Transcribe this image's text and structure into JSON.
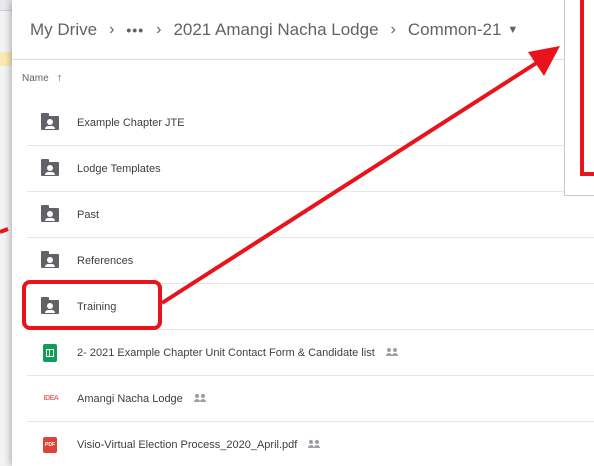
{
  "breadcrumb": {
    "root": "My Drive",
    "more": "•••",
    "folder": "2021 Amangi Nacha Lodge",
    "current": "Common-21"
  },
  "list": {
    "column_header": "Name",
    "sort_icon": "arrow-up-icon"
  },
  "files": [
    {
      "type": "shared-folder",
      "name": "Example Chapter JTE",
      "shared": false
    },
    {
      "type": "shared-folder",
      "name": "Lodge Templates",
      "shared": false
    },
    {
      "type": "shared-folder",
      "name": "Past",
      "shared": false
    },
    {
      "type": "shared-folder",
      "name": "References",
      "shared": false
    },
    {
      "type": "shared-folder",
      "name": "Training",
      "shared": false
    },
    {
      "type": "google-sheet",
      "name": "2- 2021 Example Chapter Unit Contact Form & Candidate list",
      "shared": true
    },
    {
      "type": "image",
      "name": "Amangi Nacha Lodge",
      "shared": true,
      "icon_text": "IDEA"
    },
    {
      "type": "pdf",
      "name": "Visio-Virtual Election Process_2020_April.pdf",
      "shared": true,
      "icon_text": "PDF"
    }
  ],
  "colors": {
    "annotation_red": "#e8131b",
    "folder_gray": "#5f6368",
    "sheets_green": "#0f9d58",
    "pdf_red": "#db4437"
  }
}
